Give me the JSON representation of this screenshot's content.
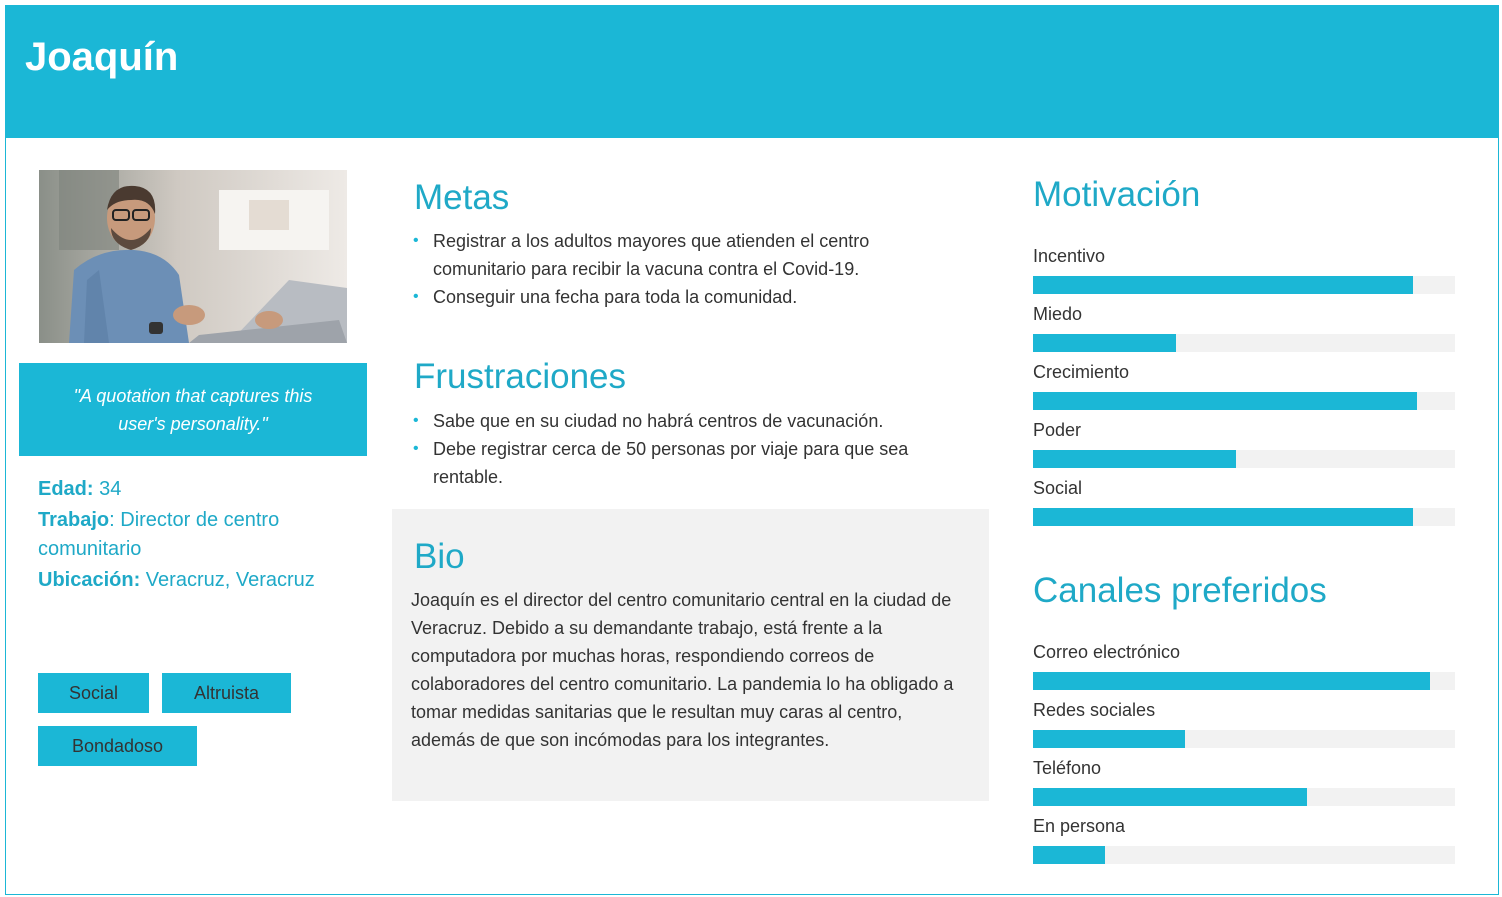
{
  "persona": {
    "name": "Joaquín",
    "quote": "\"A quotation that captures this user's personality.\"",
    "facts": [
      {
        "label": "Edad:",
        "value": " 34"
      },
      {
        "label": "Trabajo",
        "value": ": Director de centro comunitario"
      },
      {
        "label": "Ubicación:",
        "value": " Veracruz, Veracruz"
      }
    ],
    "tags": [
      "Social",
      "Altruista",
      "Bondadoso"
    ]
  },
  "goals": {
    "title": "Metas",
    "items": [
      "Registrar a los adultos mayores que atienden el centro comunitario para recibir la vacuna contra el Covid-19.",
      "Conseguir una fecha para toda la comunidad."
    ]
  },
  "frustrations": {
    "title": "Frustraciones",
    "items": [
      "Sabe que en su ciudad no habrá centros de vacunación.",
      "Debe registrar cerca de 50 personas por viaje para que sea rentable."
    ]
  },
  "bio": {
    "title": "Bio",
    "text": "Joaquín es el director del centro comunitario central en la ciudad de Veracruz. Debido a su demandante trabajo, está frente a la computadora por muchas horas, respondiendo correos de colaboradores del centro comunitario. La pandemia lo ha obligado a tomar medidas sanitarias que le resultan muy caras al centro, además de que son incómodas para los integrantes."
  },
  "motivation": {
    "title": "Motivación",
    "items": [
      {
        "label": "Incentivo",
        "level": 0.9
      },
      {
        "label": "Miedo",
        "level": 0.34
      },
      {
        "label": "Crecimiento",
        "level": 0.91
      },
      {
        "label": "Poder",
        "level": 0.48
      },
      {
        "label": "Social",
        "level": 0.9
      }
    ]
  },
  "channels": {
    "title": "Canales preferidos",
    "items": [
      {
        "label": "Correo electrónico",
        "level": 0.94
      },
      {
        "label": "Redes sociales",
        "level": 0.36
      },
      {
        "label": "Teléfono",
        "level": 0.65
      },
      {
        "label": "En persona",
        "level": 0.17
      }
    ]
  },
  "colors": {
    "accent": "#1bb7d6",
    "accent_text": "#1fa9c7",
    "bar_track": "#f2f2f2",
    "bio_bg": "#f2f2f2"
  }
}
